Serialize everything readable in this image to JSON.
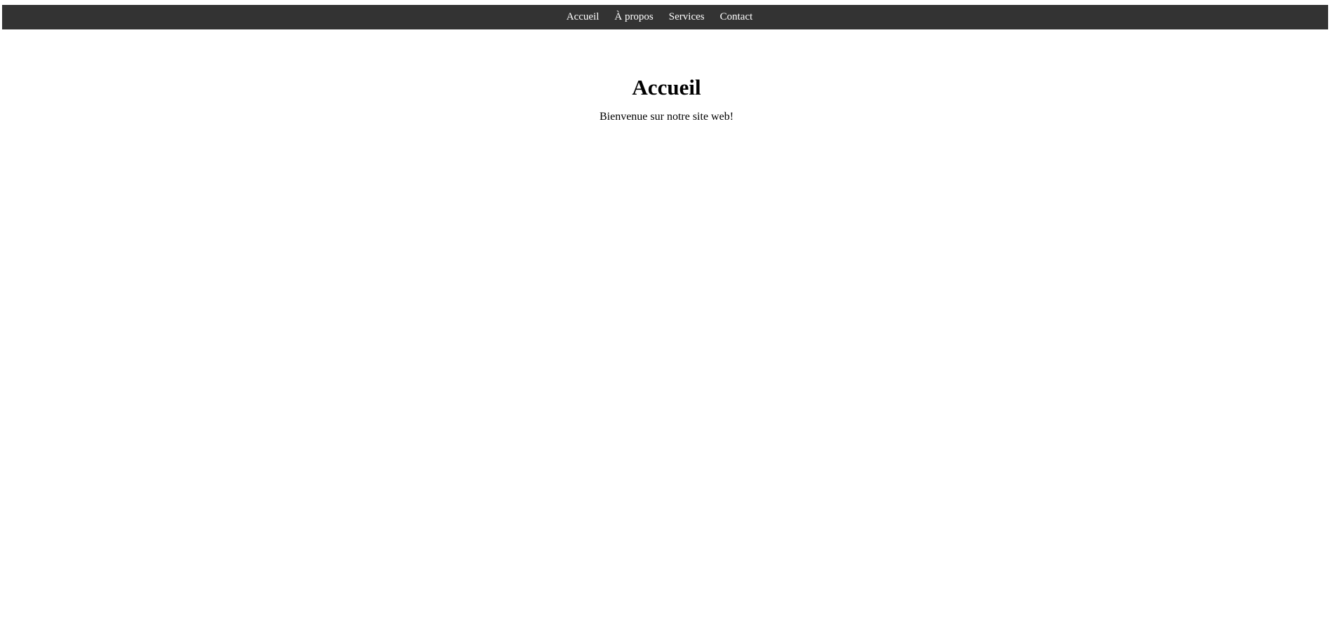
{
  "nav": {
    "items": [
      {
        "label": "Accueil"
      },
      {
        "label": "À propos"
      },
      {
        "label": "Services"
      },
      {
        "label": "Contact"
      }
    ],
    "background": "#333333",
    "text_color": "#ffffff"
  },
  "main": {
    "title": "Accueil",
    "welcome": "Bienvenue sur notre site web!"
  }
}
